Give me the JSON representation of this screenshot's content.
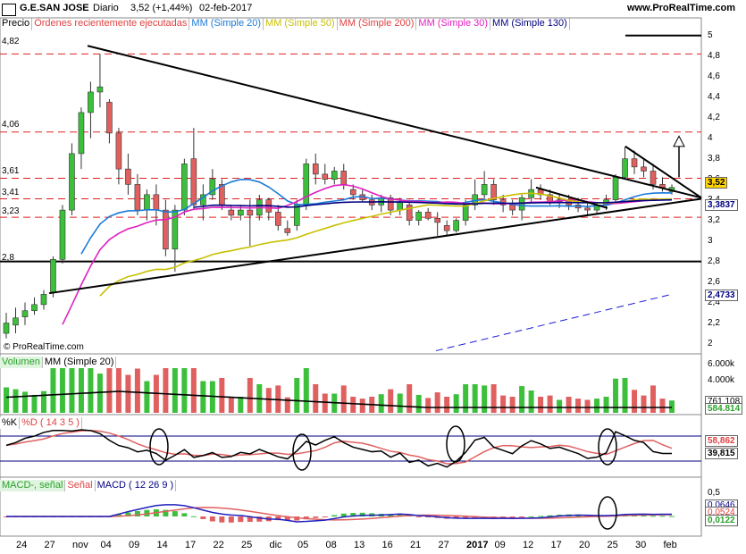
{
  "header": {
    "symbol": "G.E.SAN JOSE",
    "period": "Diario",
    "quote": "3,52 (+1,44%)",
    "date": "02-feb-2017",
    "site": "www.ProRealTime.com"
  },
  "legend": {
    "price": "Precio",
    "orders": "Órdenes recientemente ejecutadas",
    "ma20": "MM (Simple 20)",
    "ma50": "MM (Simple 50)",
    "ma200": "MM (Simple 200)",
    "ma30": "MM (Simple 30)",
    "ma130": "MM (Simple 130)"
  },
  "copyright": "© ProRealTime.com",
  "volume_legend": {
    "volume": "Volumen",
    "ma20": "MM (Simple 20)"
  },
  "stoch_legend": {
    "k": "%K",
    "d": "%D ( 14 3 5 )"
  },
  "macd_legend": {
    "macd_minus": "MACD-, señal",
    "signal": "Señal",
    "macd": "MACD ( 12 26 9 )"
  },
  "price_levels": {
    "l482": "4,82",
    "l406": "4,06",
    "l361": "3,61",
    "l341": "3,41",
    "l323": "3,23",
    "l28": "2,8"
  },
  "price_axis": [
    "5",
    "4,8",
    "4,6",
    "4,4",
    "4,2",
    "4",
    "3,8",
    "3,6",
    "3,4",
    "3,2",
    "3",
    "2,8",
    "2,6",
    "2,4",
    "2,2",
    "2"
  ],
  "price_tags": {
    "last": "3,52",
    "ma": "3,3837",
    "lower": "2,4733"
  },
  "volume_axis": {
    "top": "6.000k",
    "mid": "4.000k",
    "ma": "761.108",
    "last": "584.814"
  },
  "stoch_axis": {
    "d": "58,862",
    "k": "39,815"
  },
  "macd_axis": {
    "top": "0,5",
    "a": "0,0646",
    "b": "0,0524",
    "last": "0,0122"
  },
  "x_labels": [
    "24",
    "27",
    "nov",
    "04",
    "09",
    "14",
    "17",
    "22",
    "25",
    "dic",
    "05",
    "08",
    "13",
    "16",
    "21",
    "27",
    "2017",
    "09",
    "12",
    "17",
    "20",
    "25",
    "30",
    "feb"
  ],
  "chart_data": {
    "type": "candlestick",
    "title": "G.E.SAN JOSE",
    "period": "Diario",
    "y_range": [
      1.9,
      5.05
    ],
    "horizontal_levels": [
      4.82,
      4.06,
      3.61,
      3.41,
      3.23,
      2.8
    ],
    "last_close": 3.52,
    "change_pct": 1.44,
    "candles": [
      {
        "o": 2.1,
        "h": 2.3,
        "l": 2.05,
        "c": 2.2
      },
      {
        "o": 2.18,
        "h": 2.35,
        "l": 2.1,
        "c": 2.25
      },
      {
        "o": 2.26,
        "h": 2.4,
        "l": 2.18,
        "c": 2.32
      },
      {
        "o": 2.32,
        "h": 2.45,
        "l": 2.28,
        "c": 2.38
      },
      {
        "o": 2.38,
        "h": 2.52,
        "l": 2.33,
        "c": 2.48
      },
      {
        "o": 2.5,
        "h": 2.85,
        "l": 2.45,
        "c": 2.82
      },
      {
        "o": 2.82,
        "h": 3.35,
        "l": 2.78,
        "c": 3.3
      },
      {
        "o": 3.3,
        "h": 3.95,
        "l": 3.25,
        "c": 3.85
      },
      {
        "o": 3.85,
        "h": 4.3,
        "l": 3.7,
        "c": 4.25
      },
      {
        "o": 4.25,
        "h": 4.55,
        "l": 4.0,
        "c": 4.45
      },
      {
        "o": 4.45,
        "h": 4.82,
        "l": 4.3,
        "c": 4.5
      },
      {
        "o": 4.35,
        "h": 4.38,
        "l": 3.95,
        "c": 4.05
      },
      {
        "o": 4.05,
        "h": 4.1,
        "l": 3.55,
        "c": 3.7
      },
      {
        "o": 3.7,
        "h": 3.85,
        "l": 3.45,
        "c": 3.55
      },
      {
        "o": 3.55,
        "h": 3.65,
        "l": 3.25,
        "c": 3.3
      },
      {
        "o": 3.3,
        "h": 3.5,
        "l": 3.2,
        "c": 3.45
      },
      {
        "o": 3.45,
        "h": 3.55,
        "l": 3.15,
        "c": 3.3
      },
      {
        "o": 3.3,
        "h": 3.4,
        "l": 2.85,
        "c": 2.92
      },
      {
        "o": 2.92,
        "h": 3.35,
        "l": 2.7,
        "c": 3.3
      },
      {
        "o": 3.3,
        "h": 3.8,
        "l": 3.25,
        "c": 3.75
      },
      {
        "o": 3.8,
        "h": 4.1,
        "l": 3.3,
        "c": 3.35
      },
      {
        "o": 3.35,
        "h": 3.55,
        "l": 3.2,
        "c": 3.45
      },
      {
        "o": 3.45,
        "h": 3.7,
        "l": 3.4,
        "c": 3.6
      },
      {
        "o": 3.55,
        "h": 3.6,
        "l": 3.3,
        "c": 3.35
      },
      {
        "o": 3.3,
        "h": 3.35,
        "l": 3.2,
        "c": 3.25
      },
      {
        "o": 3.25,
        "h": 3.35,
        "l": 3.2,
        "c": 3.3
      },
      {
        "o": 3.3,
        "h": 3.4,
        "l": 2.95,
        "c": 3.25
      },
      {
        "o": 3.25,
        "h": 3.45,
        "l": 3.2,
        "c": 3.4
      },
      {
        "o": 3.4,
        "h": 3.42,
        "l": 3.2,
        "c": 3.28
      },
      {
        "o": 3.28,
        "h": 3.35,
        "l": 3.1,
        "c": 3.15
      },
      {
        "o": 3.12,
        "h": 3.2,
        "l": 3.05,
        "c": 3.08
      },
      {
        "o": 3.15,
        "h": 3.4,
        "l": 3.1,
        "c": 3.35
      },
      {
        "o": 3.35,
        "h": 3.8,
        "l": 3.3,
        "c": 3.75
      },
      {
        "o": 3.75,
        "h": 3.85,
        "l": 3.55,
        "c": 3.65
      },
      {
        "o": 3.65,
        "h": 3.75,
        "l": 3.55,
        "c": 3.6
      },
      {
        "o": 3.6,
        "h": 3.72,
        "l": 3.55,
        "c": 3.68
      },
      {
        "o": 3.68,
        "h": 3.75,
        "l": 3.5,
        "c": 3.55
      },
      {
        "o": 3.5,
        "h": 3.55,
        "l": 3.4,
        "c": 3.45
      },
      {
        "o": 3.45,
        "h": 3.5,
        "l": 3.38,
        "c": 3.4
      },
      {
        "o": 3.4,
        "h": 3.45,
        "l": 3.3,
        "c": 3.35
      },
      {
        "o": 3.35,
        "h": 3.45,
        "l": 3.28,
        "c": 3.42
      },
      {
        "o": 3.42,
        "h": 3.45,
        "l": 3.25,
        "c": 3.3
      },
      {
        "o": 3.3,
        "h": 3.42,
        "l": 3.25,
        "c": 3.38
      },
      {
        "o": 3.35,
        "h": 3.4,
        "l": 3.15,
        "c": 3.2
      },
      {
        "o": 3.2,
        "h": 3.3,
        "l": 3.15,
        "c": 3.28
      },
      {
        "o": 3.28,
        "h": 3.32,
        "l": 3.2,
        "c": 3.22
      },
      {
        "o": 3.22,
        "h": 3.28,
        "l": 3.05,
        "c": 3.18
      },
      {
        "o": 3.15,
        "h": 3.2,
        "l": 3.05,
        "c": 3.1
      },
      {
        "o": 3.1,
        "h": 3.22,
        "l": 3.08,
        "c": 3.2
      },
      {
        "o": 3.2,
        "h": 3.4,
        "l": 3.15,
        "c": 3.35
      },
      {
        "o": 3.35,
        "h": 3.6,
        "l": 3.3,
        "c": 3.45
      },
      {
        "o": 3.45,
        "h": 3.68,
        "l": 3.4,
        "c": 3.55
      },
      {
        "o": 3.55,
        "h": 3.6,
        "l": 3.35,
        "c": 3.4
      },
      {
        "o": 3.4,
        "h": 3.45,
        "l": 3.28,
        "c": 3.35
      },
      {
        "o": 3.35,
        "h": 3.4,
        "l": 3.25,
        "c": 3.3
      },
      {
        "o": 3.3,
        "h": 3.45,
        "l": 3.2,
        "c": 3.42
      },
      {
        "o": 3.42,
        "h": 3.6,
        "l": 3.38,
        "c": 3.5
      },
      {
        "o": 3.5,
        "h": 3.55,
        "l": 3.4,
        "c": 3.45
      },
      {
        "o": 3.45,
        "h": 3.5,
        "l": 3.35,
        "c": 3.38
      },
      {
        "o": 3.38,
        "h": 3.45,
        "l": 3.32,
        "c": 3.4
      },
      {
        "o": 3.4,
        "h": 3.45,
        "l": 3.3,
        "c": 3.35
      },
      {
        "o": 3.35,
        "h": 3.42,
        "l": 3.28,
        "c": 3.32
      },
      {
        "o": 3.32,
        "h": 3.38,
        "l": 3.25,
        "c": 3.3
      },
      {
        "o": 3.3,
        "h": 3.38,
        "l": 3.26,
        "c": 3.35
      },
      {
        "o": 3.35,
        "h": 3.45,
        "l": 3.3,
        "c": 3.4
      },
      {
        "o": 3.4,
        "h": 3.65,
        "l": 3.38,
        "c": 3.62
      },
      {
        "o": 3.62,
        "h": 3.92,
        "l": 3.6,
        "c": 3.8
      },
      {
        "o": 3.8,
        "h": 3.88,
        "l": 3.65,
        "c": 3.72
      },
      {
        "o": 3.72,
        "h": 3.8,
        "l": 3.62,
        "c": 3.68
      },
      {
        "o": 3.68,
        "h": 3.75,
        "l": 3.5,
        "c": 3.55
      },
      {
        "o": 3.55,
        "h": 3.62,
        "l": 3.48,
        "c": 3.52
      },
      {
        "o": 3.48,
        "h": 3.55,
        "l": 3.45,
        "c": 3.52
      }
    ]
  }
}
